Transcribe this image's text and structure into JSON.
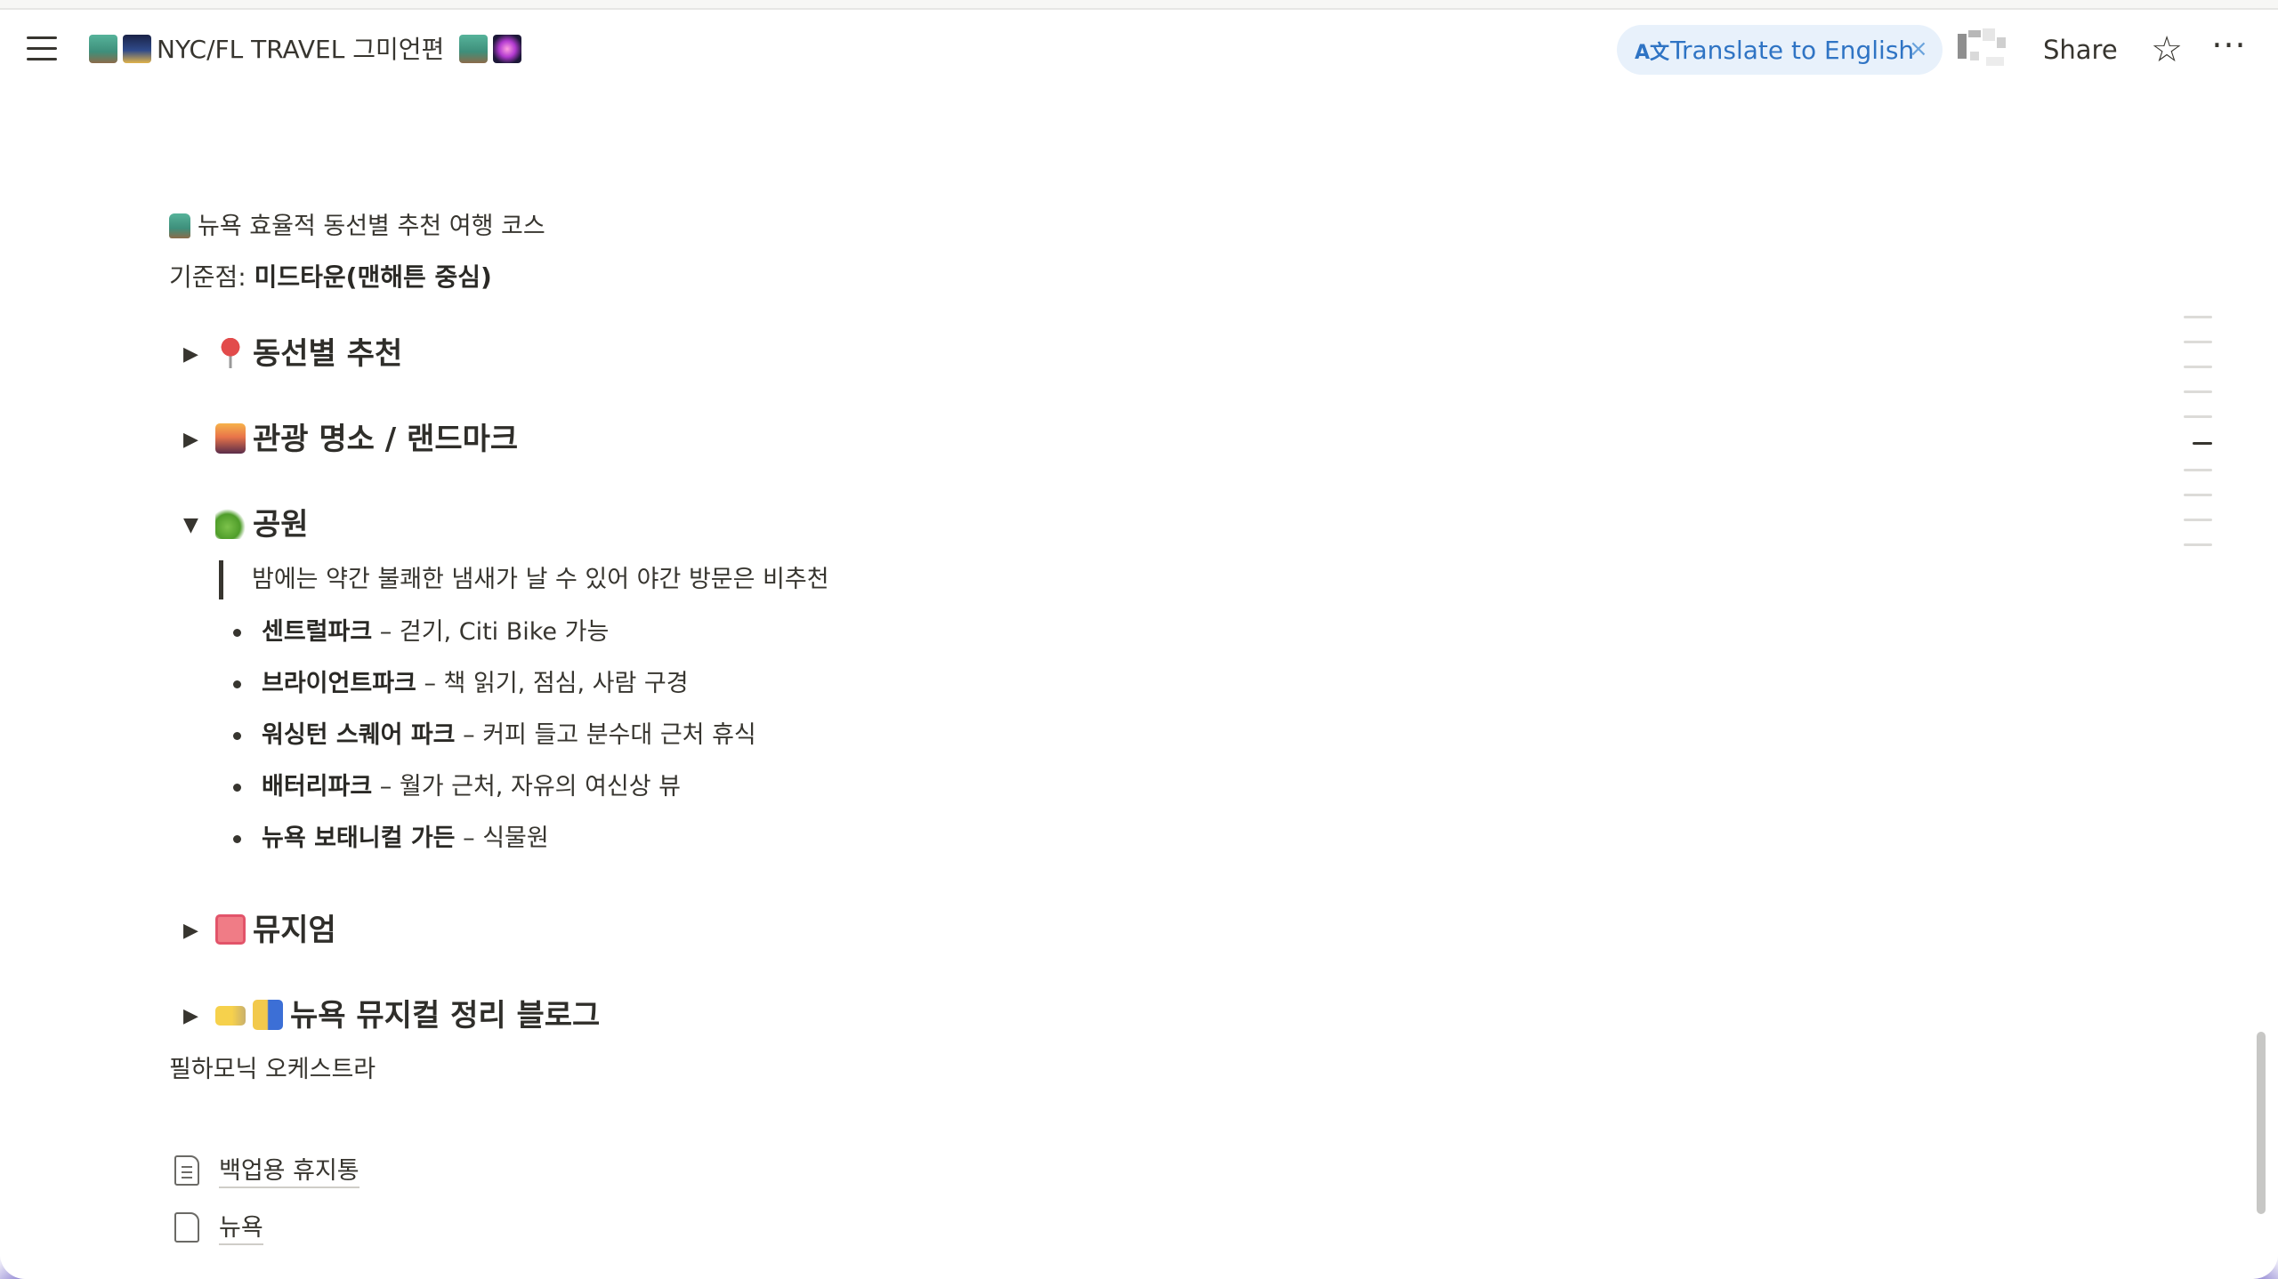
{
  "topbar": {
    "title": "NYC/FL TRAVEL 그미언편",
    "translate_label": "Translate to English",
    "translate_icon": "A文",
    "translate_close": "×",
    "share_label": "Share",
    "star_icon": "☆",
    "more_icon": "···"
  },
  "page": {
    "intro": "뉴욕 효율적 동선별 추천 여행 코스",
    "base_prefix": "기준점: ",
    "base_value": "미드타운(맨해튼 중심)",
    "sections": [
      {
        "label": "동선별 추천",
        "expanded": false,
        "icon": "pin-icon"
      },
      {
        "label": "관광 명소 / 랜드마크",
        "expanded": false,
        "icon": "cityscape-icon"
      },
      {
        "label": "공원",
        "expanded": true,
        "icon": "leaf-icon"
      },
      {
        "label": "뮤지엄",
        "expanded": false,
        "icon": "ticket-icon"
      },
      {
        "label": "뉴욕 뮤지컬 정리 블로그",
        "expanded": false,
        "icon": "theater-icon"
      }
    ],
    "arrow_collapsed": "▶",
    "arrow_expanded": "▼",
    "park_note": "밤에는 약간 불쾌한 냄새가 날 수 있어 야간 방문은 비추천",
    "parks": [
      {
        "name": "센트럴파크",
        "desc": " – 걷기, Citi Bike 가능"
      },
      {
        "name": "브라이언트파크",
        "desc": " – 책 읽기, 점심, 사람 구경"
      },
      {
        "name": "워싱턴 스퀘어 파크",
        "desc": " – 커피 들고 분수대 근처 휴식"
      },
      {
        "name": "배터리파크",
        "desc": " – 월가 근처, 자유의 여신상 뷰"
      },
      {
        "name": "뉴욕 보태니컬 가든",
        "desc": " – 식물원"
      }
    ],
    "plain_text": "필하모닉 오케스트라",
    "links": [
      {
        "label": "백업용 휴지통",
        "icon": "document-icon"
      },
      {
        "label": "뉴욕",
        "icon": "page-icon"
      }
    ]
  },
  "colors": {
    "text": "#37352f",
    "translate_bg": "#e8f1fb",
    "translate_text": "#2f74c4"
  }
}
